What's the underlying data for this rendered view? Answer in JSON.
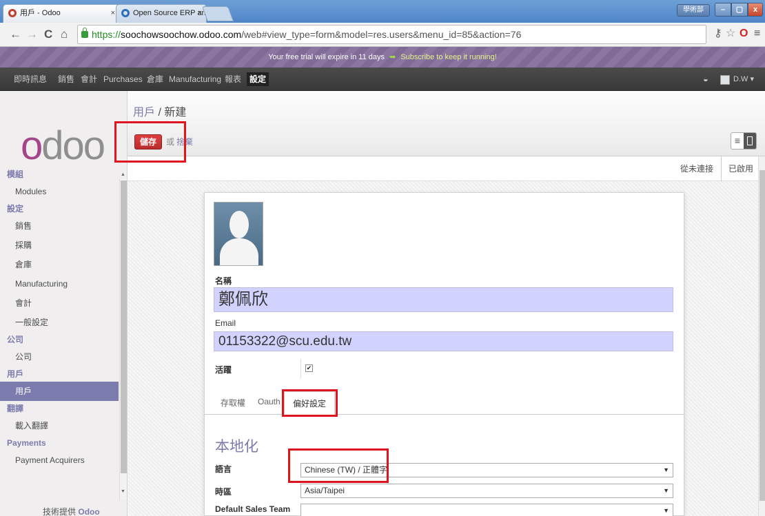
{
  "browser": {
    "tabs": [
      {
        "label": "用戶 - Odoo",
        "close": "×"
      },
      {
        "label": "Open Source ERP and CI",
        "close": "×"
      }
    ],
    "profile": "學術部",
    "win_min": "–",
    "win_max": "▢",
    "win_close": "x",
    "url_scheme": "https://",
    "url_host": "soochowsoochow.odoo.com",
    "url_path": "/web#view_type=form&model=res.users&menu_id=85&action=76",
    "nav_back": "←",
    "nav_fwd": "→",
    "reload": "C",
    "home": "⌂"
  },
  "trial": {
    "text": "Your free trial will expire in 11 days",
    "arrow": "➡",
    "subscribe": "Subscribe to keep it running!"
  },
  "topmenu": {
    "items": [
      "即時訊息",
      "銷售",
      "會計",
      "Purchases",
      "倉庫",
      "Manufacturing",
      "報表",
      "設定"
    ],
    "user": "D.W ▾",
    "search_icon": "chat-icon"
  },
  "sidebar": {
    "logo_o": "o",
    "logo_doo": "doo",
    "entries": [
      {
        "type": "head",
        "label": "模組"
      },
      {
        "type": "item",
        "label": "Modules"
      },
      {
        "type": "head",
        "label": "設定"
      },
      {
        "type": "item",
        "label": "銷售"
      },
      {
        "type": "item",
        "label": "採購"
      },
      {
        "type": "item",
        "label": "倉庫"
      },
      {
        "type": "item",
        "label": "Manufacturing"
      },
      {
        "type": "item",
        "label": "會計"
      },
      {
        "type": "item",
        "label": "一般設定"
      },
      {
        "type": "head",
        "label": "公司"
      },
      {
        "type": "item",
        "label": "公司"
      },
      {
        "type": "head",
        "label": "用戶"
      },
      {
        "type": "item",
        "label": "用戶",
        "active": true
      },
      {
        "type": "head",
        "label": "翻譯"
      },
      {
        "type": "item",
        "label": "載入翻譯"
      },
      {
        "type": "head",
        "label": "Payments"
      },
      {
        "type": "item",
        "label": "Payment Acquirers"
      }
    ],
    "powered": "技術提供",
    "powered_brand": "Odoo"
  },
  "header": {
    "bc_link": "用戶",
    "bc_sep": " / ",
    "bc_current": "新建",
    "save": "儲存",
    "or": "或",
    "discard": "捨棄",
    "list_icon": "≡"
  },
  "status": {
    "never": "從未連接",
    "enabled": "已啟用"
  },
  "form": {
    "name_label": "名稱",
    "name_value": "鄭佩欣",
    "email_label": "Email",
    "email_value": "01153322@scu.edu.tw",
    "active_label": "活躍",
    "active_check": "✔",
    "tabs": [
      "存取權",
      "Oauth",
      "偏好設定"
    ],
    "section": "本地化",
    "lang_label": "語言",
    "lang_value": "Chinese (TW) / 正體字",
    "tz_label": "時區",
    "tz_value": "Asia/Taipei",
    "team_label": "Default Sales Team",
    "team_value": "",
    "dd": "▼"
  },
  "colors": {
    "accent": "#7c7bad",
    "save": "#c9302c",
    "highlight": "#e0141e",
    "field": "#d2d2ff"
  }
}
